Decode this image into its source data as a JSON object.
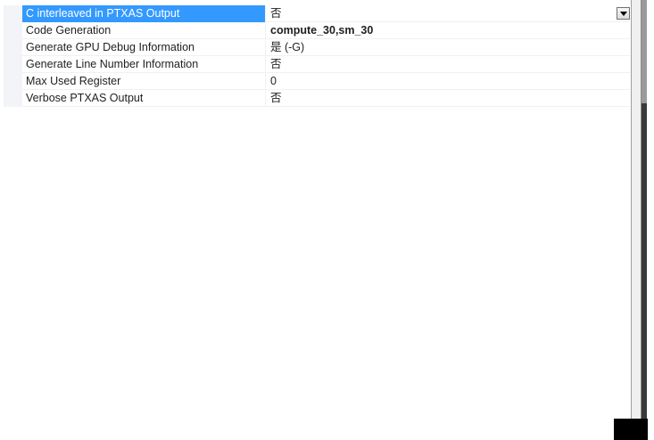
{
  "property_grid": {
    "rows": [
      {
        "name": "C interleaved in PTXAS Output",
        "value": "否"
      },
      {
        "name": "Code Generation",
        "value": "compute_30,sm_30"
      },
      {
        "name": "Generate GPU Debug Information",
        "value": "是 (-G)"
      },
      {
        "name": "Generate Line Number Information",
        "value": "否"
      },
      {
        "name": "Max Used Register",
        "value": "0"
      },
      {
        "name": "Verbose PTXAS Output",
        "value": "否"
      }
    ],
    "selected_row": 0,
    "dropdown_icon": "chevron-down-icon"
  },
  "colors": {
    "selection": "#3399ff",
    "gutter": "#f2f4f8",
    "row_separator": "#eef1f6"
  }
}
